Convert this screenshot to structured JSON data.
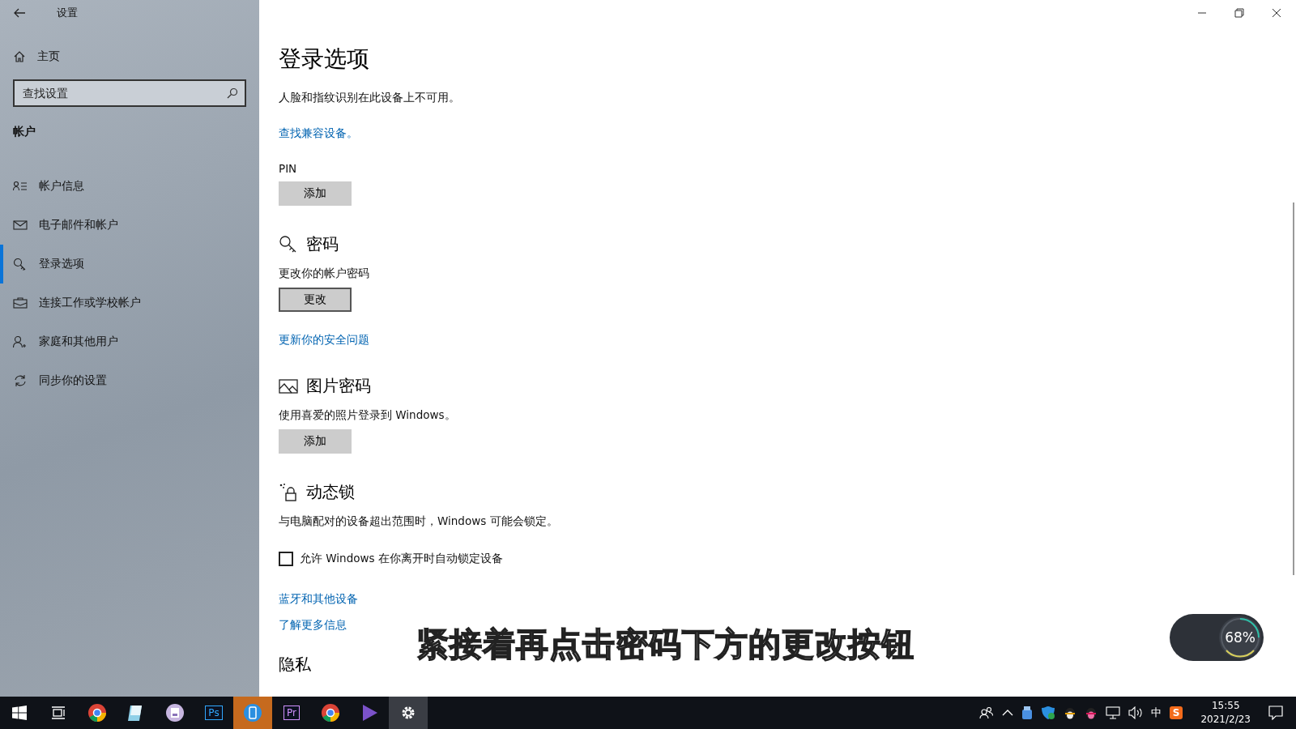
{
  "window": {
    "title": "设置"
  },
  "sidebar": {
    "home": "主页",
    "search": {
      "placeholder": "查找设置"
    },
    "section": "帐户",
    "items": [
      {
        "label": "帐户信息",
        "selected": false
      },
      {
        "label": "电子邮件和帐户",
        "selected": false
      },
      {
        "label": "登录选项",
        "selected": true
      },
      {
        "label": "连接工作或学校帐户",
        "selected": false
      },
      {
        "label": "家庭和其他用户",
        "selected": false
      },
      {
        "label": "同步你的设置",
        "selected": false
      }
    ]
  },
  "page": {
    "title": "登录选项",
    "sections": [
      {
        "kind": "intro",
        "text": "人脸和指纹识别在此设备上不可用。",
        "link": "查找兼容设备。"
      },
      {
        "kind": "plain",
        "heading": "PIN",
        "button": "添加",
        "button_focused": false
      },
      {
        "kind": "section",
        "heading": "密码",
        "text": "更改你的帐户密码",
        "button": "更改",
        "button_focused": true,
        "link": "更新你的安全问题"
      },
      {
        "kind": "section",
        "heading": "图片密码",
        "text": "使用喜爱的照片登录到 Windows。",
        "button": "添加",
        "button_focused": false
      },
      {
        "kind": "section",
        "heading": "动态锁",
        "text": "与电脑配对的设备超出范围时，Windows 可能会锁定。",
        "checkbox": {
          "label": "允许 Windows 在你离开时自动锁定设备",
          "checked": false
        },
        "links": [
          "蓝牙和其他设备",
          "了解更多信息"
        ]
      },
      {
        "kind": "heading-only",
        "heading": "隐私"
      }
    ]
  },
  "caption": "紧接着再点击密码下方的更改按钮",
  "meter": {
    "reading": "68%"
  },
  "taskbar": {
    "apps": [
      {
        "kind": "start",
        "active": false
      },
      {
        "kind": "task-view",
        "active": false
      },
      {
        "kind": "chrome",
        "active": false
      },
      {
        "kind": "notepad",
        "active": false
      },
      {
        "kind": "disk",
        "active": false
      },
      {
        "kind": "tile",
        "label": "Ps",
        "color": "#31a8ff",
        "active": false
      },
      {
        "kind": "phone",
        "active": true
      },
      {
        "kind": "tile",
        "label": "Pr",
        "color": "#d291ff",
        "active": false
      },
      {
        "kind": "chrome",
        "active": false
      },
      {
        "kind": "play",
        "active": false
      },
      {
        "kind": "gear",
        "active": true
      }
    ],
    "ime": "中",
    "sogou": "S",
    "time": "15:55",
    "date": "2021/2/23"
  }
}
